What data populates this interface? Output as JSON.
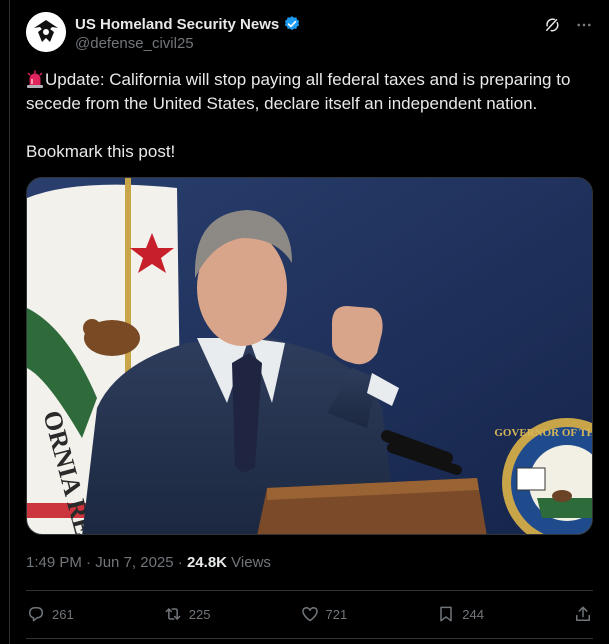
{
  "author": {
    "display_name": "US Homeland Security News",
    "handle": "@defense_civil25",
    "verified": true,
    "avatar_icon": "shield-seal-icon"
  },
  "post": {
    "line1": "Update: California will stop paying all federal taxes and is preparing to secede from the United States, declare itself an independent nation.",
    "line2": "Bookmark this post!",
    "lead_icon": "siren-icon"
  },
  "meta": {
    "time": "1:49 PM",
    "date": "Jun 7, 2025",
    "views_count": "24.8K",
    "views_label": "Views"
  },
  "actions": {
    "replies": "261",
    "reposts": "225",
    "likes": "721",
    "bookmarks": "244"
  },
  "colors": {
    "background": "#000000",
    "text": "#e7e9ea",
    "muted": "#71767b",
    "verified": "#1d9bf0",
    "border": "#2f3336"
  }
}
